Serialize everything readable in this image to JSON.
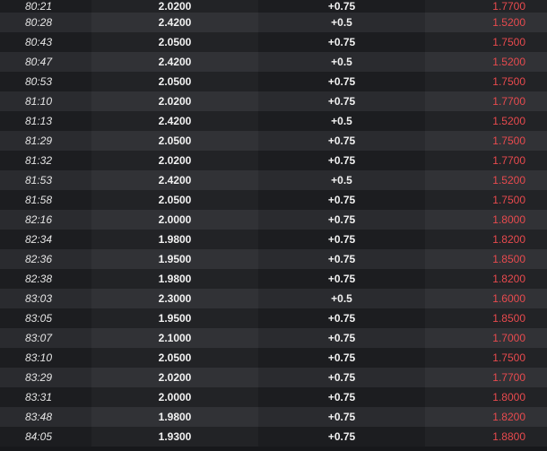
{
  "colors": {
    "background": "#17181b",
    "row_dark": "#1c1d20",
    "row_light": "#2a2b2f",
    "text": "#f2f2f2",
    "away_odds": "#e84a4e"
  },
  "rows": [
    {
      "time": "80:21",
      "home": "2.0200",
      "line": "+0.75",
      "away": "1.7700"
    },
    {
      "time": "80:28",
      "home": "2.4200",
      "line": "+0.5",
      "away": "1.5200"
    },
    {
      "time": "80:43",
      "home": "2.0500",
      "line": "+0.75",
      "away": "1.7500"
    },
    {
      "time": "80:47",
      "home": "2.4200",
      "line": "+0.5",
      "away": "1.5200"
    },
    {
      "time": "80:53",
      "home": "2.0500",
      "line": "+0.75",
      "away": "1.7500"
    },
    {
      "time": "81:10",
      "home": "2.0200",
      "line": "+0.75",
      "away": "1.7700"
    },
    {
      "time": "81:13",
      "home": "2.4200",
      "line": "+0.5",
      "away": "1.5200"
    },
    {
      "time": "81:29",
      "home": "2.0500",
      "line": "+0.75",
      "away": "1.7500"
    },
    {
      "time": "81:32",
      "home": "2.0200",
      "line": "+0.75",
      "away": "1.7700"
    },
    {
      "time": "81:53",
      "home": "2.4200",
      "line": "+0.5",
      "away": "1.5200"
    },
    {
      "time": "81:58",
      "home": "2.0500",
      "line": "+0.75",
      "away": "1.7500"
    },
    {
      "time": "82:16",
      "home": "2.0000",
      "line": "+0.75",
      "away": "1.8000"
    },
    {
      "time": "82:34",
      "home": "1.9800",
      "line": "+0.75",
      "away": "1.8200"
    },
    {
      "time": "82:36",
      "home": "1.9500",
      "line": "+0.75",
      "away": "1.8500"
    },
    {
      "time": "82:38",
      "home": "1.9800",
      "line": "+0.75",
      "away": "1.8200"
    },
    {
      "time": "83:03",
      "home": "2.3000",
      "line": "+0.5",
      "away": "1.6000"
    },
    {
      "time": "83:05",
      "home": "1.9500",
      "line": "+0.75",
      "away": "1.8500"
    },
    {
      "time": "83:07",
      "home": "2.1000",
      "line": "+0.75",
      "away": "1.7000"
    },
    {
      "time": "83:10",
      "home": "2.0500",
      "line": "+0.75",
      "away": "1.7500"
    },
    {
      "time": "83:29",
      "home": "2.0200",
      "line": "+0.75",
      "away": "1.7700"
    },
    {
      "time": "83:31",
      "home": "2.0000",
      "line": "+0.75",
      "away": "1.8000"
    },
    {
      "time": "83:48",
      "home": "1.9800",
      "line": "+0.75",
      "away": "1.8200"
    },
    {
      "time": "84:05",
      "home": "1.9300",
      "line": "+0.75",
      "away": "1.8800"
    }
  ]
}
